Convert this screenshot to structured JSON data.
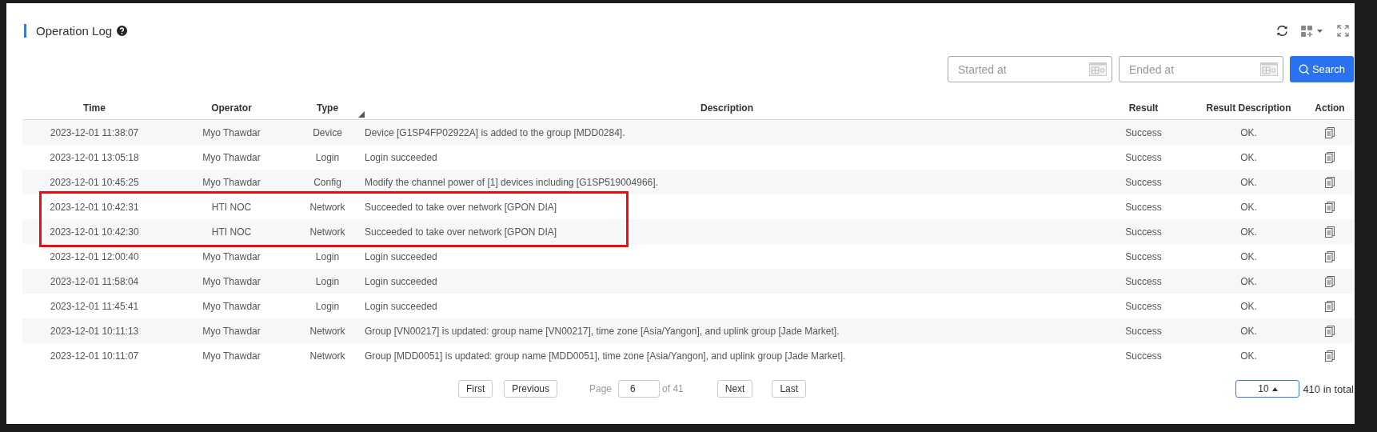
{
  "header": {
    "title": "Operation Log"
  },
  "filters": {
    "start": {
      "placeholder": "Started at"
    },
    "end": {
      "placeholder": "Ended at"
    },
    "search_button": "Search"
  },
  "table": {
    "columns": [
      {
        "label": "Time",
        "sorted": false
      },
      {
        "label": "Operator",
        "sorted": false
      },
      {
        "label": "Type",
        "sorted": true
      },
      {
        "label": "Description",
        "sorted": false
      },
      {
        "label": "Result",
        "sorted": false
      },
      {
        "label": "Result Description",
        "sorted": false
      },
      {
        "label": "Action",
        "sorted": false
      }
    ],
    "rows": [
      {
        "time": "2023-12-01 11:38:07",
        "operator": "Myo Thawdar",
        "type": "Device",
        "description": "Device [G1SP4FP02922A] is added to the group [MDD0284].",
        "result": "Success",
        "result_description": "OK.",
        "highlighted": false
      },
      {
        "time": "2023-12-01 13:05:18",
        "operator": "Myo Thawdar",
        "type": "Login",
        "description": "Login succeeded",
        "result": "Success",
        "result_description": "OK.",
        "highlighted": false
      },
      {
        "time": "2023-12-01 10:45:25",
        "operator": "Myo Thawdar",
        "type": "Config",
        "description": "Modify the channel power of [1] devices including [G1SP519004966].",
        "result": "Success",
        "result_description": "OK.",
        "highlighted": false
      },
      {
        "time": "2023-12-01 10:42:31",
        "operator": "HTI NOC",
        "type": "Network",
        "description": "Succeeded to take over network [GPON DIA]",
        "result": "Success",
        "result_description": "OK.",
        "highlighted": true
      },
      {
        "time": "2023-12-01 10:42:30",
        "operator": "HTI NOC",
        "type": "Network",
        "description": "Succeeded to take over network [GPON DIA]",
        "result": "Success",
        "result_description": "OK.",
        "highlighted": true
      },
      {
        "time": "2023-12-01 12:00:40",
        "operator": "Myo Thawdar",
        "type": "Login",
        "description": "Login succeeded",
        "result": "Success",
        "result_description": "OK.",
        "highlighted": false
      },
      {
        "time": "2023-12-01 11:58:04",
        "operator": "Myo Thawdar",
        "type": "Login",
        "description": "Login succeeded",
        "result": "Success",
        "result_description": "OK.",
        "highlighted": false
      },
      {
        "time": "2023-12-01 11:45:41",
        "operator": "Myo Thawdar",
        "type": "Login",
        "description": "Login succeeded",
        "result": "Success",
        "result_description": "OK.",
        "highlighted": false
      },
      {
        "time": "2023-12-01 10:11:13",
        "operator": "Myo Thawdar",
        "type": "Network",
        "description": "Group [VN00217] is updated: group name [VN00217], time zone [Asia/Yangon], and uplink group [Jade Market].",
        "result": "Success",
        "result_description": "OK.",
        "highlighted": false
      },
      {
        "time": "2023-12-01 10:11:07",
        "operator": "Myo Thawdar",
        "type": "Network",
        "description": "Group [MDD0051] is updated: group name [MDD0051], time zone [Asia/Yangon], and uplink group [Jade Market].",
        "result": "Success",
        "result_description": "OK.",
        "highlighted": false
      }
    ]
  },
  "pager": {
    "first": "First",
    "previous": "Previous",
    "page_label": "Page",
    "page": "6",
    "page_count": "of 41",
    "next": "Next",
    "last": "Last",
    "page_size": "10",
    "total": "410 in total"
  }
}
